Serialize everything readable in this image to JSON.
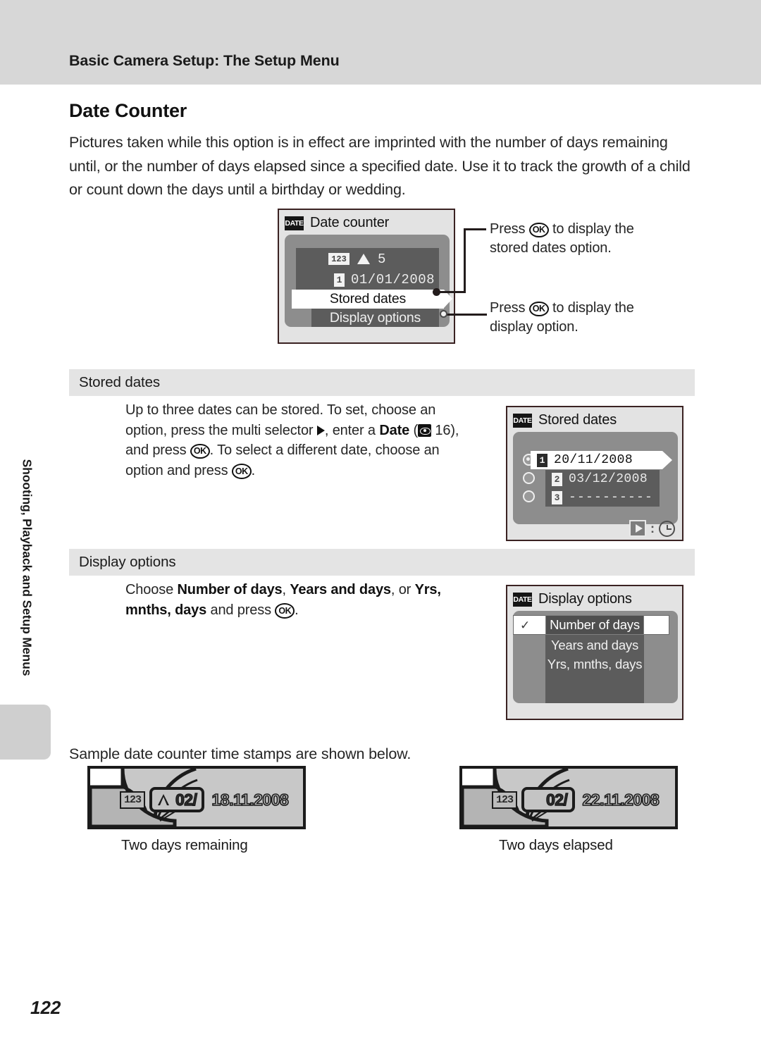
{
  "header": {
    "running_title": "Basic Camera Setup: The Setup Menu"
  },
  "page": {
    "title": "Date Counter",
    "number": "122",
    "side_tab_label": "Shooting, Playback and Setup Menus",
    "intro": "Pictures taken while this option is in effect are imprinted with the number of days remaining until, or the number of days elapsed since a specified date. Use it to track the growth of a child or count down the days until a birthday or wedding.",
    "sample_line": "Sample date counter time stamps are shown below."
  },
  "screens": {
    "date_counter": {
      "badge": "DATE",
      "title": "Date counter",
      "counter_icon": "123",
      "counter_value": "5",
      "slot_number": "1",
      "slot_date": "01/01/2008",
      "menu_selected": "Stored dates",
      "menu_unselected": "Display options"
    },
    "stored_dates": {
      "badge": "DATE",
      "title": "Stored dates",
      "rows": [
        {
          "slot": "1",
          "date": "20/11/2008",
          "selected": true
        },
        {
          "slot": "2",
          "date": "03/12/2008",
          "selected": false
        },
        {
          "slot": "3",
          "date": "----------",
          "selected": false
        }
      ],
      "footer_hint": ":"
    },
    "display_options": {
      "badge": "DATE",
      "title": "Display options",
      "options": [
        "Number of days",
        "Years and days",
        "Yrs, mnths, days"
      ],
      "checked_option": "Number of days"
    }
  },
  "callouts": {
    "stored_dates": "Press ⒪ to display the stored dates option.",
    "display_option": "Press ⒪ to display the display option."
  },
  "callout_parts": {
    "press_1a": "Press",
    "press_1b": "to display the stored dates option.",
    "press_2a": "Press",
    "press_2b": "to display the display option.",
    "ok_label": "OK"
  },
  "sections": {
    "stored_dates": {
      "heading": "Stored dates",
      "body_prefix": "Up to three dates can be stored. To set, choose an option, press the multi selector",
      "body_mid": ", enter a",
      "body_bold_date": "Date",
      "body_ref": "16), and press",
      "body_suffix": ". To select a different date, choose an option and press"
    },
    "display_options": {
      "heading": "Display options",
      "body_prefix": "Choose",
      "opt1": "Number of days",
      "opt2": "Years and days",
      "opt3": "Yrs, mnths, days",
      "body_or": ", or",
      "body_suffix": "and press"
    }
  },
  "samples": {
    "left": {
      "icon": "123",
      "marker": "triangle-up",
      "days": "02/",
      "date": "18.11.2008",
      "caption": "Two days remaining"
    },
    "right": {
      "icon": "123",
      "marker": "none",
      "days": "02/",
      "date": "22.11.2008",
      "caption": "Two days elapsed"
    }
  },
  "colors": {
    "header_band": "#d7d7d7",
    "section_band": "#e4e4e4",
    "screen_bg": "#e3e3e3",
    "screen_body": "#8d8d8d",
    "screen_row": "#5c5c5c",
    "ink": "#1a1a1a"
  }
}
